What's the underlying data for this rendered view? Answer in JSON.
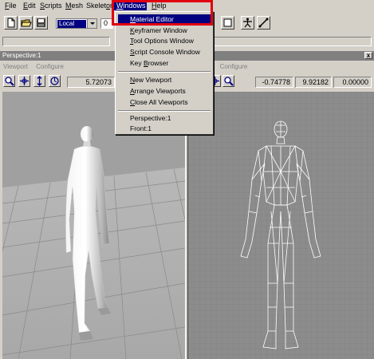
{
  "menubar": {
    "items": [
      {
        "pre": "",
        "ul": "F",
        "post": "ile"
      },
      {
        "pre": "",
        "ul": "E",
        "post": "dit"
      },
      {
        "pre": "",
        "ul": "S",
        "post": "cripts"
      },
      {
        "pre": "",
        "ul": "M",
        "post": "esh"
      },
      {
        "pre": "Skelet",
        "ul": "o",
        "post": "n"
      },
      {
        "pre": "",
        "ul": "W",
        "post": "indows"
      },
      {
        "pre": "",
        "ul": "H",
        "post": "elp"
      }
    ]
  },
  "toolbar": {
    "mode_value": "Local",
    "value_fragment": "0"
  },
  "windows_menu": {
    "items": [
      {
        "pre": "",
        "ul": "M",
        "post": "aterial Editor",
        "highlighted": true
      },
      {
        "pre": "",
        "ul": "K",
        "post": "eyframer Window"
      },
      {
        "pre": "",
        "ul": "T",
        "post": "ool Options Window"
      },
      {
        "pre": "",
        "ul": "S",
        "post": "cript Console Window"
      },
      {
        "pre": "Key ",
        "ul": "B",
        "post": "rowser"
      },
      {
        "pre": "",
        "ul": "N",
        "post": "ew Viewport"
      },
      {
        "pre": "",
        "ul": "A",
        "post": "rrange Viewports"
      },
      {
        "pre": "",
        "ul": "C",
        "post": "lose All Viewports"
      },
      {
        "pre": "Perspective:1",
        "ul": "",
        "post": ""
      },
      {
        "pre": "Front:1",
        "ul": "",
        "post": ""
      }
    ]
  },
  "viewport_window": {
    "title": "Perspective:1",
    "close_label": "x",
    "left": {
      "menu_viewport": "Viewport",
      "menu_configure": "Configure",
      "value": "5.72073"
    },
    "right": {
      "menu_viewport_fragment": "ort",
      "menu_configure": "Configure",
      "values": [
        "-0.74778",
        "9.92182",
        "0.00000"
      ]
    }
  },
  "colors": {
    "chrome": "#d4d0c8",
    "highlight": "#000080",
    "callout": "#e00010",
    "ortho_bg": "#8c8c8c"
  }
}
